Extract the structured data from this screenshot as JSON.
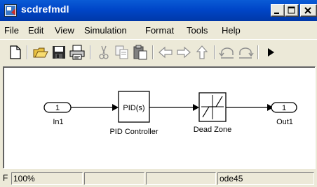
{
  "window": {
    "title": "scdrefmdl"
  },
  "menu": [
    "File",
    "Edit",
    "View",
    "Simulation",
    "Format",
    "Tools",
    "Help"
  ],
  "toolbar": {
    "buttons": [
      "new-file-icon",
      "open-folder-icon",
      "save-icon",
      "print-icon",
      "cut-icon",
      "copy-icon",
      "paste-icon",
      "back-arrow-icon",
      "forward-arrow-icon",
      "up-arrow-icon",
      "undo-icon",
      "redo-icon",
      "start-simulation-icon"
    ]
  },
  "diagram": {
    "blocks": {
      "in1": {
        "port": "1",
        "label": "In1"
      },
      "pid": {
        "text": "PID(s)",
        "label": "PID Controller"
      },
      "deadzone": {
        "label": "Dead Zone"
      },
      "out1": {
        "port": "1",
        "label": "Out1"
      }
    }
  },
  "status": {
    "left": "F",
    "zoom": "100%",
    "solver": "ode45"
  }
}
